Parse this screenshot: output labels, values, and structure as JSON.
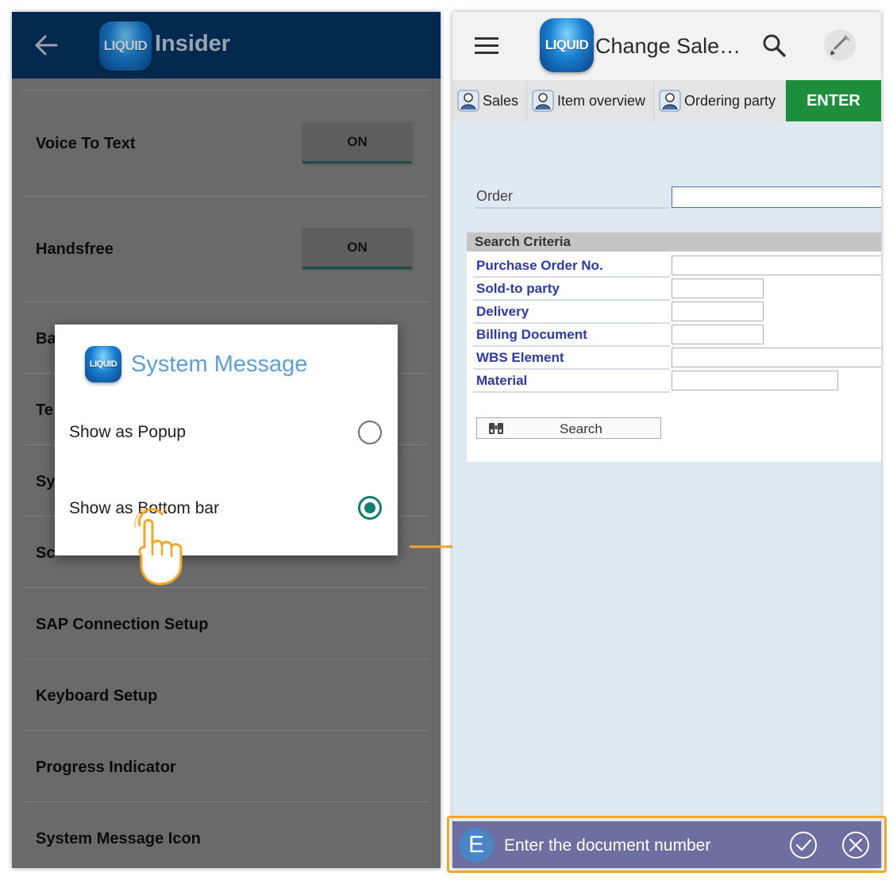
{
  "left": {
    "app_title": "Insider",
    "logo_text": "LIQUID",
    "settings": [
      {
        "label": "Voice To Text",
        "toggle": "ON"
      },
      {
        "label": "Handsfree",
        "toggle": "ON"
      },
      {
        "label": "Ba"
      },
      {
        "label": "Te"
      },
      {
        "label": "Sy"
      },
      {
        "label": "Sc"
      },
      {
        "label": "SAP Connection Setup"
      },
      {
        "label": "Keyboard Setup"
      },
      {
        "label": "Progress Indicator"
      },
      {
        "label": "System Message Icon"
      }
    ],
    "dialog": {
      "logo_text": "LIQUID",
      "title": "System Message",
      "options": [
        {
          "label": "Show as Popup",
          "selected": false
        },
        {
          "label": "Show as Bottom bar",
          "selected": true
        }
      ]
    }
  },
  "right": {
    "logo_text": "LIQUID",
    "title": "Change Sale…",
    "tabs": [
      "Sales",
      "Item overview",
      "Ordering party"
    ],
    "enter_label": "ENTER",
    "order_label": "Order",
    "order_value": "",
    "criteria_title": "Search Criteria",
    "criteria": [
      {
        "label": "Purchase Order No.",
        "value": ""
      },
      {
        "label": "Sold-to party",
        "value": ""
      },
      {
        "label": "Delivery",
        "value": ""
      },
      {
        "label": "Billing Document",
        "value": ""
      },
      {
        "label": "WBS Element",
        "value": ""
      },
      {
        "label": "Material",
        "value": ""
      }
    ],
    "search_button": "Search",
    "bottom_bar": {
      "badge": "E",
      "message": "Enter the document number"
    }
  },
  "colors": {
    "left_appbar": "#032a4e",
    "dialog_title": "#5da0d3",
    "radio_selected": "#13806e",
    "enter_button": "#1d8e3b",
    "criteria_label": "#2b3aa8",
    "bottom_bar": "#6c6fa0",
    "highlight": "#f5a623"
  }
}
